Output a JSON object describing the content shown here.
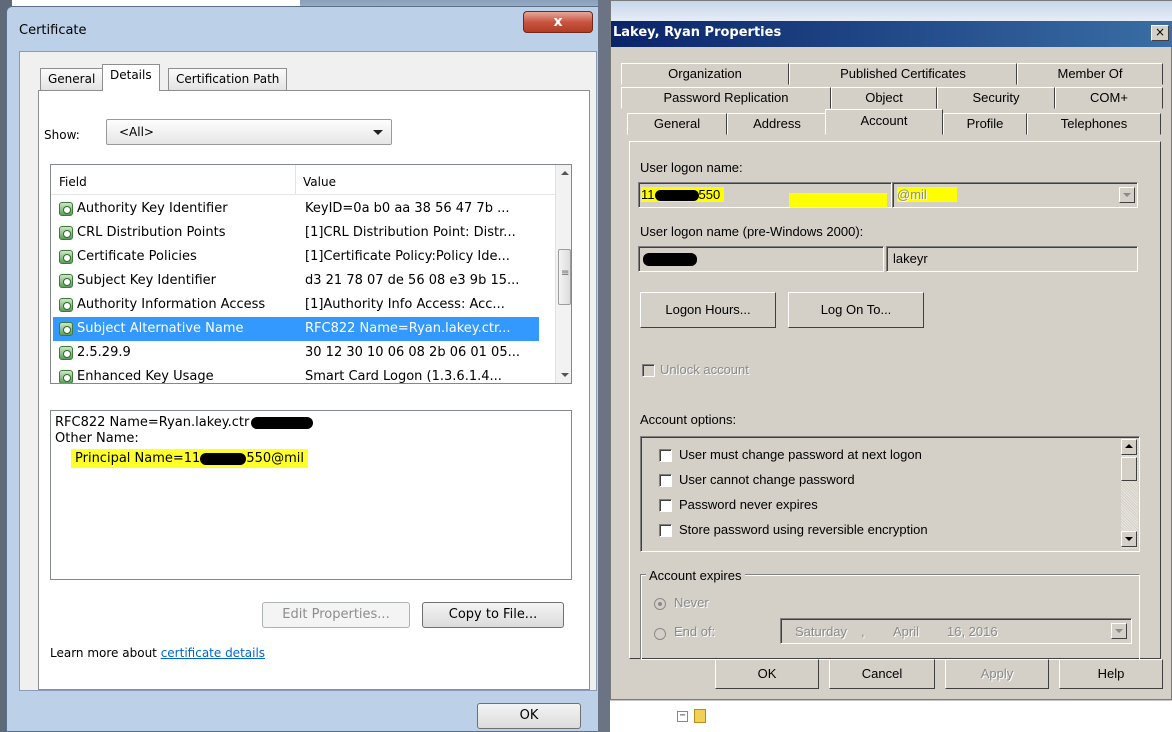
{
  "certificate": {
    "window_title": "Certificate",
    "close_glyph": "x",
    "tabs": [
      {
        "label": "General"
      },
      {
        "label": "Details"
      },
      {
        "label": "Certification Path"
      }
    ],
    "show_label": "Show:",
    "show_value": "<All>",
    "columns": {
      "field": "Field",
      "value": "Value"
    },
    "rows": [
      {
        "field": "Authority Key Identifier",
        "value": "KeyID=0a b0 aa 38 56 47 7b ..."
      },
      {
        "field": "CRL Distribution Points",
        "value": "[1]CRL Distribution Point: Distr..."
      },
      {
        "field": "Certificate Policies",
        "value": "[1]Certificate Policy:Policy Ide..."
      },
      {
        "field": "Subject Key Identifier",
        "value": "d3 21 78 07 de 56 08 e3 9b 15..."
      },
      {
        "field": "Authority Information Access",
        "value": "[1]Authority Info Access: Acc..."
      },
      {
        "field": "Subject Alternative Name",
        "value": "RFC822 Name=Ryan.lakey.ctr..."
      },
      {
        "field": "2.5.29.9",
        "value": "30 12 30 10 06 08 2b 06 01 05..."
      },
      {
        "field": "Enhanced Key Usage",
        "value": "Smart Card Logon (1.3.6.1.4..."
      }
    ],
    "detail": {
      "line1": "RFC822 Name=Ryan.lakey.ctr",
      "line2": "Other Name:",
      "line3_prefix": "Principal Name=11",
      "line3_suffix": "550@mil"
    },
    "edit_properties": "Edit Properties...",
    "copy_to_file": "Copy to File...",
    "learn_prefix": "Learn more about ",
    "learn_link": "certificate details",
    "ok": "OK"
  },
  "properties": {
    "window_title": "Lakey, Ryan Properties",
    "close_glyph": "×",
    "tabs_row1": [
      {
        "label": "Organization"
      },
      {
        "label": "Published Certificates"
      },
      {
        "label": "Member Of"
      }
    ],
    "tabs_row2": [
      {
        "label": "Password Replication"
      },
      {
        "label": "Object"
      },
      {
        "label": "Security"
      },
      {
        "label": "COM+"
      }
    ],
    "tabs_row3": [
      {
        "label": "General"
      },
      {
        "label": "Address"
      },
      {
        "label": "Account"
      },
      {
        "label": "Profile"
      },
      {
        "label": "Telephones"
      }
    ],
    "user_logon_label": "User logon name:",
    "user_logon_prefix": "11",
    "user_logon_suffix": "550",
    "domain_value": "@mil",
    "pre2000_label": "User logon name (pre-Windows 2000):",
    "pre2000_value": "lakeyr",
    "logon_hours": "Logon Hours...",
    "log_on_to": "Log On To...",
    "unlock_account": "Unlock account",
    "account_options_label": "Account options:",
    "options": [
      {
        "label": "User must change password at next logon"
      },
      {
        "label": "User cannot change password"
      },
      {
        "label": "Password never expires"
      },
      {
        "label": "Store password using reversible encryption"
      }
    ],
    "account_expires_label": "Account expires",
    "never": "Never",
    "end_of": "End of:",
    "date_day": "Saturday",
    "date_sep": ",",
    "date_month": "April",
    "date_rest": "16, 2016",
    "ok": "OK",
    "cancel": "Cancel",
    "apply": "Apply",
    "help": "Help"
  }
}
